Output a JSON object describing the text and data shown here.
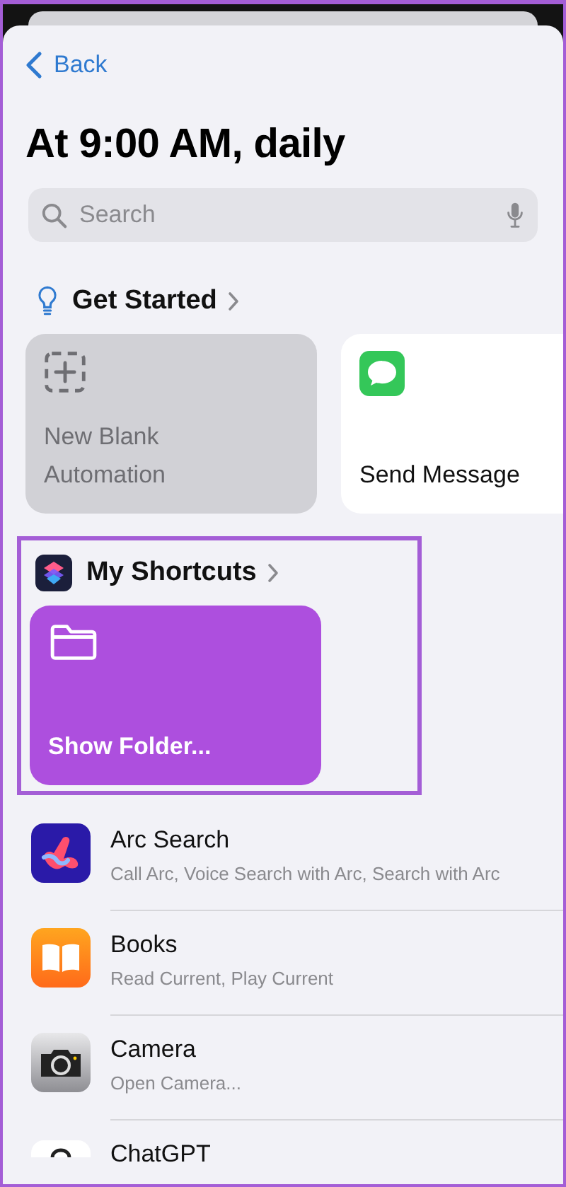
{
  "nav": {
    "back": "Back"
  },
  "title": "At 9:00 AM, daily",
  "search": {
    "placeholder": "Search"
  },
  "sections": [
    {
      "title": "Get Started",
      "kind": "suggestions",
      "highlighted": false,
      "cards": [
        {
          "label": "New Blank Automation",
          "kind": "blank"
        },
        {
          "label": "Send Message",
          "kind": "message"
        }
      ]
    },
    {
      "title": "My Shortcuts",
      "kind": "shortcuts",
      "highlighted": true,
      "cards": [
        {
          "label": "Show Folder...",
          "kind": "folder"
        }
      ]
    }
  ],
  "apps": [
    {
      "name": "Arc Search",
      "actions": "Call Arc, Voice Search with Arc, Search with Arc",
      "kind": "arc"
    },
    {
      "name": "Books",
      "actions": "Read Current, Play Current",
      "kind": "books"
    },
    {
      "name": "Camera",
      "actions": "Open Camera...",
      "kind": "camera"
    },
    {
      "name": "ChatGPT",
      "kind": "chatgpt"
    }
  ]
}
